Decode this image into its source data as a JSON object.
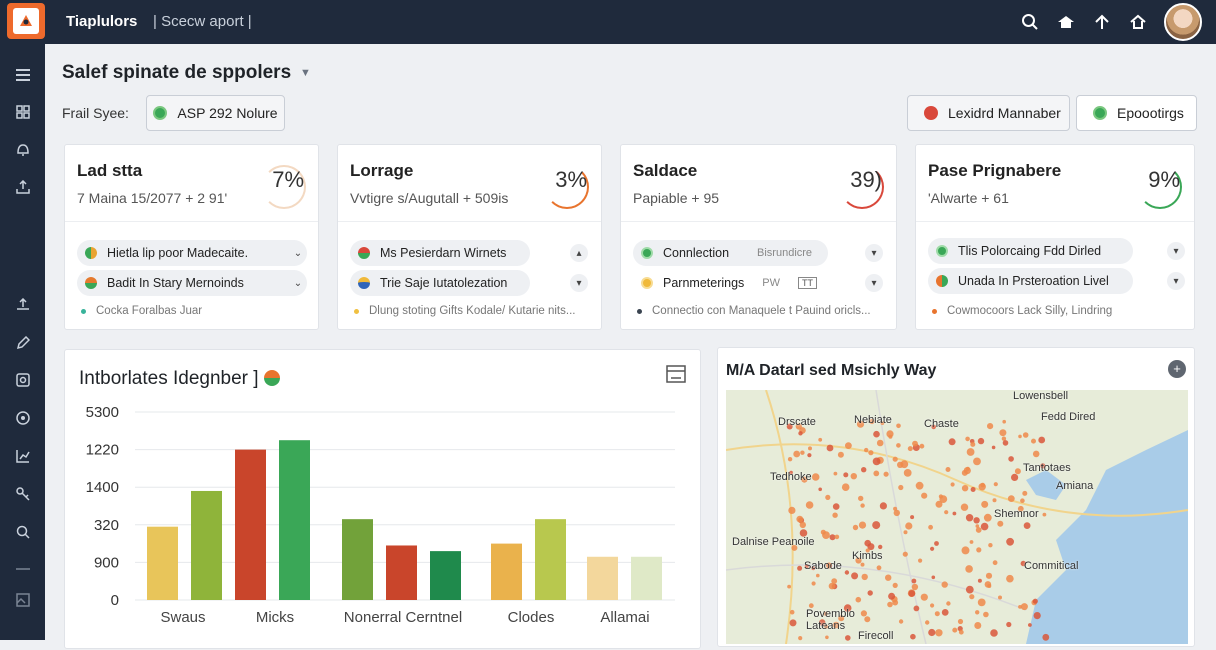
{
  "app": {
    "brand": "Tiaplulors",
    "subtitle": "Scecw aport"
  },
  "header": {
    "title": "Salef spinate de sppolers"
  },
  "filter": {
    "label": "Frail Syee:",
    "chip": "ASP 292 Nolure",
    "action1": "Lexidrd Mannaber",
    "action2": "Epoootirgs"
  },
  "colors": {
    "accent": "#ee6a2c",
    "topbar": "#1f2a3c",
    "green": "#3aa757",
    "orange": "#e8742e",
    "red": "#c9452b"
  },
  "cards": [
    {
      "title": "Lad stta",
      "sub": "7 Maina 15/2077 + 2 91'",
      "percent": "7%",
      "ring_color": "#e8a46c",
      "items": [
        {
          "label": "Hietla lip poor Madecaite.",
          "dot": "#e8a331"
        },
        {
          "label": "Badit In Stary Mernoinds",
          "dot": "#e57a2e"
        }
      ],
      "foot": "Cocka Foralbas Juar",
      "foot_dot": "#38b39a"
    },
    {
      "title": "Lorrage",
      "sub": "Vvtigre s/Augutall + 509is",
      "percent": "3%",
      "ring_color": "#e8742e",
      "items": [
        {
          "label": "Ms Pesierdarn Wirnets",
          "dot": "#d9483b"
        },
        {
          "label": "Trie Saje Iutatolezation",
          "dot": "#2f64b9"
        }
      ],
      "foot": "Dlung stoting Gifts Kodale/ Kutarie nits...",
      "foot_dot": "#f0c040"
    },
    {
      "title": "Saldace",
      "sub": "Papiable + 95",
      "percent": "39)",
      "ring_color": "#d9483b",
      "items": [
        {
          "label": "Connlection",
          "extra": "Bisrundicre",
          "dot": "#3aa757"
        },
        {
          "label": "Parnmeterings",
          "extra": "PW",
          "dot": "#f0b93a"
        }
      ],
      "foot": "Connectio con Manaquele t Pauind oricls...",
      "foot_dot": "#3a4450"
    },
    {
      "title": "Pase Prignabere",
      "sub": "'Alwarte + 61",
      "percent": "9%",
      "ring_color": "#3aa757",
      "items": [
        {
          "label": "Tlis Polorcaing Fdd Dirled",
          "dot": "#3aa757"
        },
        {
          "label": "Unada In Prsteroation Livel",
          "dot": "#e8742e"
        }
      ],
      "foot": "Cowmocoors Lack Silly, Lindring",
      "foot_dot": "#e8742e"
    }
  ],
  "chart_panel": {
    "title": "Intborlates Idegnber ]"
  },
  "chart_data": {
    "type": "bar",
    "y_ticks": [
      "5300",
      "1220",
      "1400",
      "320",
      "900",
      "0"
    ],
    "categories": [
      "Swaus",
      "Micks",
      "Nonerral Cerntnel",
      "Clodes",
      "Allamai"
    ],
    "series": [
      {
        "color": "#e8c55a",
        "values": [
          4.6,
          0,
          0,
          0,
          0
        ]
      },
      {
        "color": "#8fb43a",
        "values": [
          6.9,
          0,
          4.5,
          0,
          0
        ]
      },
      {
        "color": "#c9452b",
        "values": [
          9.5,
          0,
          3.5,
          0,
          0
        ]
      },
      {
        "color": "#3aa757",
        "values": [
          10.0,
          0,
          3.1,
          0,
          0
        ]
      }
    ],
    "bars": [
      {
        "color": "#e8c55a",
        "value": 3.9
      },
      {
        "color": "#8fb43a",
        "value": 5.8
      },
      {
        "color": "#c9452b",
        "value": 8.0
      },
      {
        "color": "#3aa757",
        "value": 8.5
      },
      {
        "color": "#72a23a",
        "value": 4.3
      },
      {
        "color": "#c9452b",
        "value": 2.9
      },
      {
        "color": "#1f8a4c",
        "value": 2.6
      },
      {
        "color": "#eab24c",
        "value": 3.0
      },
      {
        "color": "#b8c84e",
        "value": 4.3
      },
      {
        "color": "#f3d79c",
        "value": 2.3
      },
      {
        "color": "#dfe9c7",
        "value": 2.3
      }
    ],
    "bar_groups": [
      0,
      0,
      1,
      1,
      2,
      2,
      2,
      3,
      3,
      4,
      4
    ],
    "ylim": [
      0,
      10
    ]
  },
  "map_panel": {
    "title": "M/A Datarl sed Msichly Way",
    "labels": [
      "Lowensbell",
      "Nebiate",
      "Chaste",
      "Fedd Dired",
      "Drscate",
      "Tantotaes",
      "Tedhoke",
      "Amiana",
      "Shemnor",
      "Dalnise Peanoile",
      "Kimbs",
      "Sabode",
      "Commitical",
      "Povemblo",
      "Lateans",
      "Firecoll"
    ]
  }
}
